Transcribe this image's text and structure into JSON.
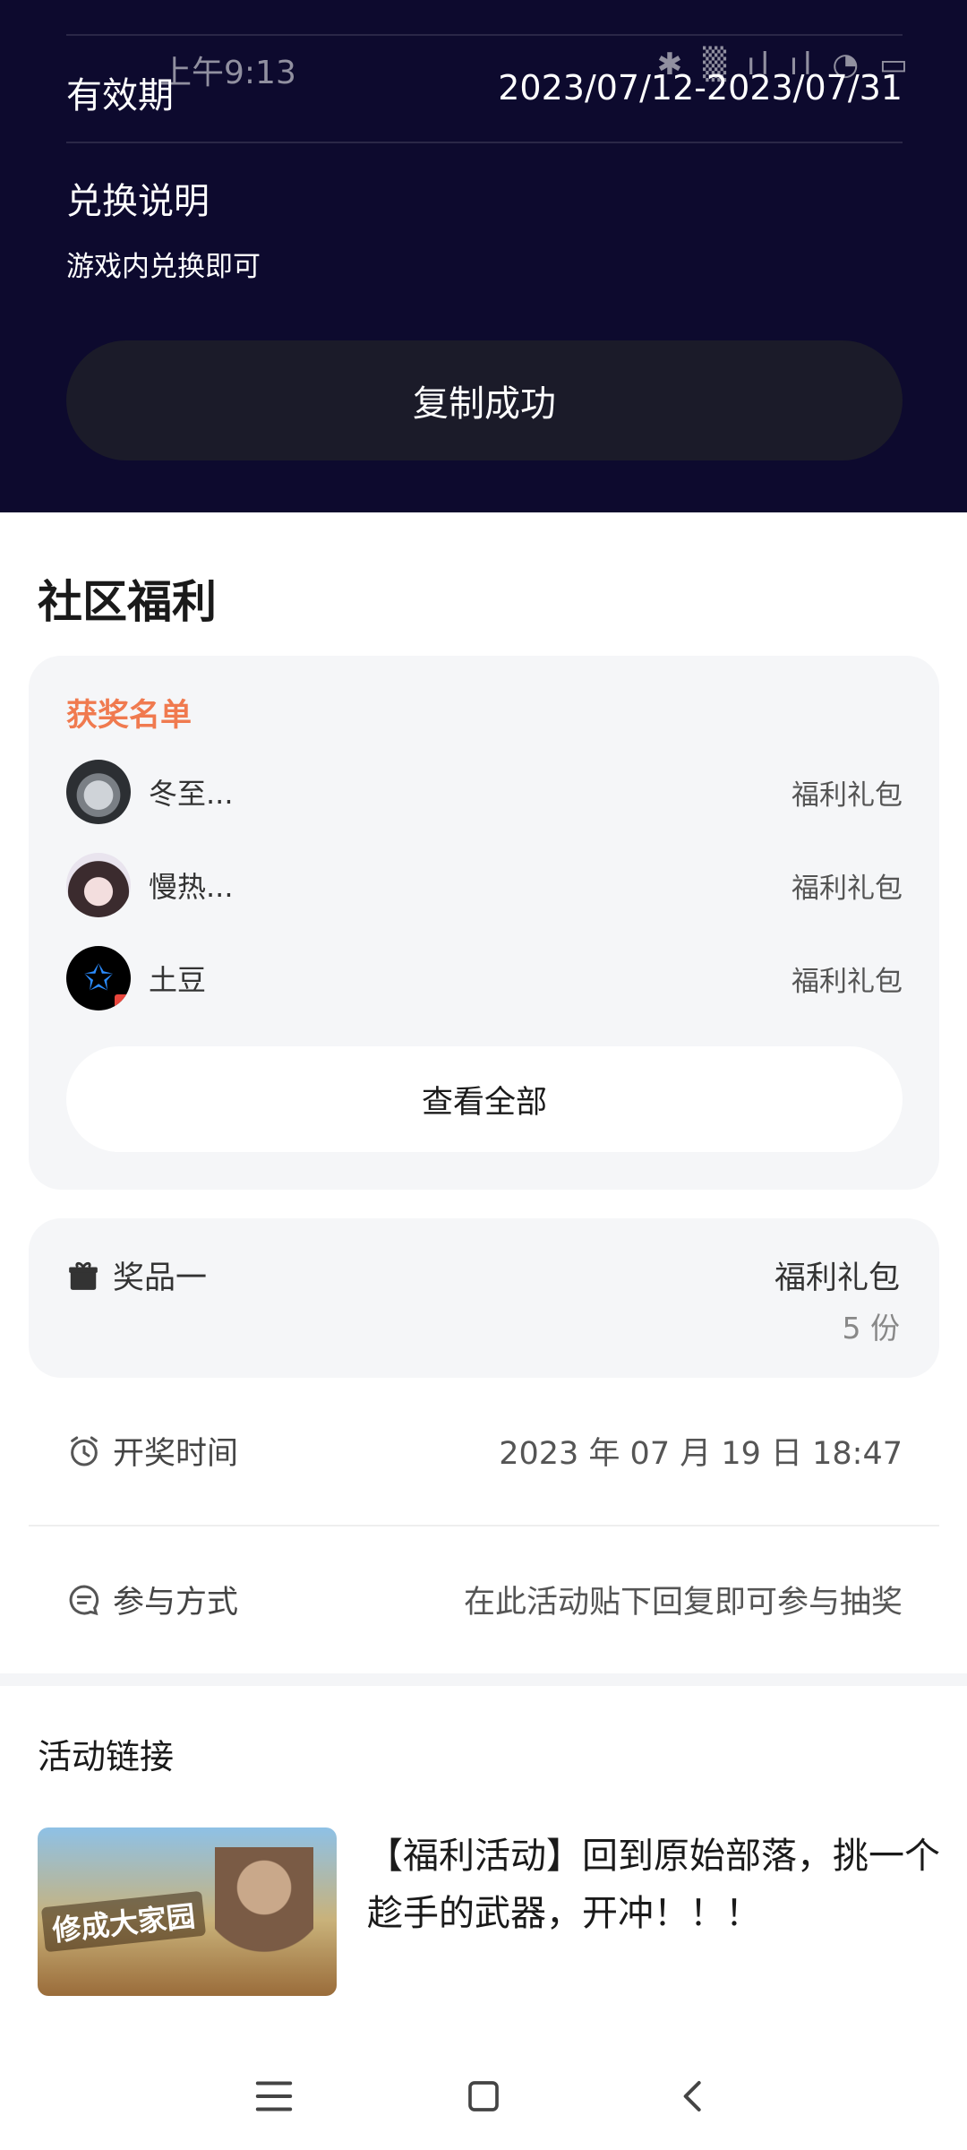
{
  "status_bar": {
    "time": "上午9:13",
    "icons": "✱ ▒ ıl ıl ◔ ▭"
  },
  "redemption": {
    "validity_label": "有效期",
    "validity_value": "2023/07/12-2023/07/31",
    "exchange_title": "兑换说明",
    "exchange_desc": "游戏内兑换即可",
    "copy_button": "复制成功"
  },
  "community": {
    "section_title": "社区福利",
    "winners_title": "获奖名单",
    "winners": [
      {
        "name": "冬至...",
        "prize": "福利礼包",
        "avatar": "car-avatar"
      },
      {
        "name": "慢热...",
        "prize": "福利礼包",
        "avatar": "girl-avatar"
      },
      {
        "name": "土豆",
        "prize": "福利礼包",
        "avatar": "star-avatar"
      }
    ],
    "view_all": "查看全部",
    "prize": {
      "label": "奖品一",
      "name": "福利礼包",
      "count": "5 份"
    },
    "draw_time": {
      "label": "开奖时间",
      "value": "2023 年 07 月 19 日 18:47"
    },
    "participation": {
      "label": "参与方式",
      "value": "在此活动贴下回复即可参与抽奖"
    }
  },
  "activity": {
    "section_title": "活动链接",
    "thumbnail_text": "修成大家园",
    "title": "【福利活动】回到原始部落，挑一个趁手的武器，开冲！！！"
  },
  "colors": {
    "dark_bg": "#0d0a2e",
    "accent_orange": "#f07a4f",
    "card_bg": "#f5f6f8"
  }
}
